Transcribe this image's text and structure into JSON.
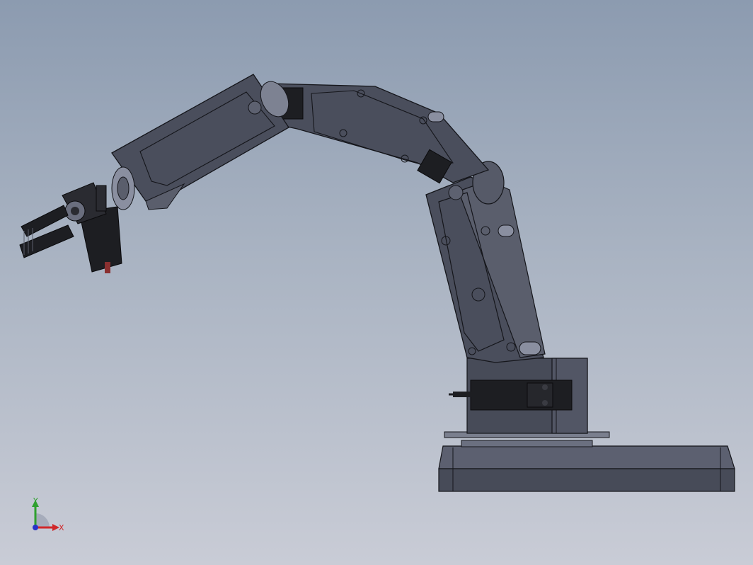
{
  "viewport": {
    "background_top": "#8c9bb0",
    "background_bottom": "#c9ccd6"
  },
  "model": {
    "part_color": "#4a4e5c",
    "edge_color": "#15161b",
    "highlight_color": "#8a8fa0",
    "servo_color": "#1d1e22"
  },
  "triad": {
    "y_label": "Y",
    "x_label": "X",
    "y_color": "#2fa02f",
    "x_color": "#d0282a",
    "z_color": "#2833c8"
  }
}
